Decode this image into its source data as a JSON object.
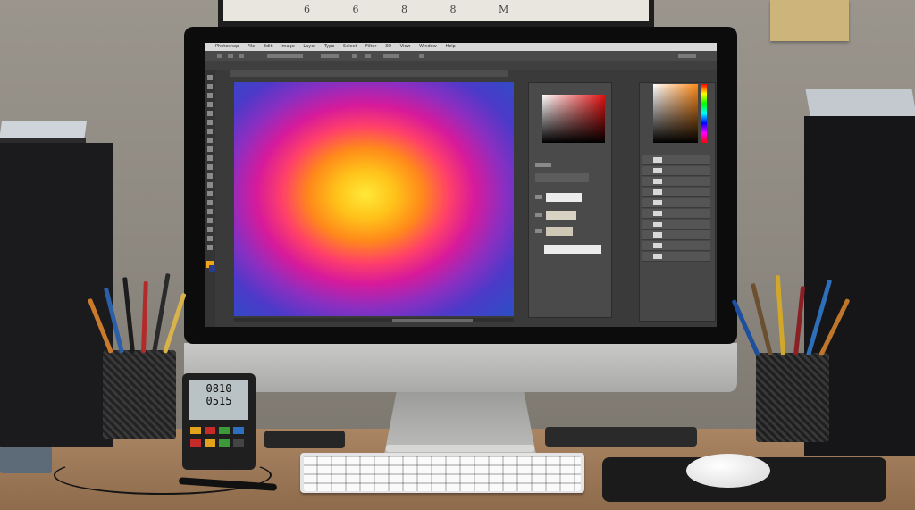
{
  "scene": {
    "frame_text": "6 6 8 8 M",
    "meter_display": [
      "0810",
      "0515"
    ],
    "menu_items": [
      "Photoshop",
      "File",
      "Edit",
      "Image",
      "Layer",
      "Type",
      "Select",
      "Filter",
      "3D",
      "View",
      "Window",
      "Help"
    ]
  },
  "canvas": {
    "gradient_colors": [
      "#ffe93a",
      "#ff8a1a",
      "#ff3f6a",
      "#d71a9b",
      "#8b2fc1",
      "#2c4fc3"
    ]
  }
}
